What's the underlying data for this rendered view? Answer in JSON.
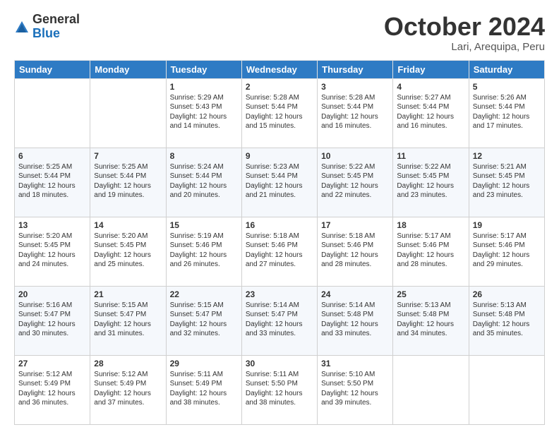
{
  "logo": {
    "general": "General",
    "blue": "Blue"
  },
  "header": {
    "month": "October 2024",
    "location": "Lari, Arequipa, Peru"
  },
  "weekdays": [
    "Sunday",
    "Monday",
    "Tuesday",
    "Wednesday",
    "Thursday",
    "Friday",
    "Saturday"
  ],
  "weeks": [
    [
      {
        "day": "",
        "info": ""
      },
      {
        "day": "",
        "info": ""
      },
      {
        "day": "1",
        "info": "Sunrise: 5:29 AM\nSunset: 5:43 PM\nDaylight: 12 hours and 14 minutes."
      },
      {
        "day": "2",
        "info": "Sunrise: 5:28 AM\nSunset: 5:44 PM\nDaylight: 12 hours and 15 minutes."
      },
      {
        "day": "3",
        "info": "Sunrise: 5:28 AM\nSunset: 5:44 PM\nDaylight: 12 hours and 16 minutes."
      },
      {
        "day": "4",
        "info": "Sunrise: 5:27 AM\nSunset: 5:44 PM\nDaylight: 12 hours and 16 minutes."
      },
      {
        "day": "5",
        "info": "Sunrise: 5:26 AM\nSunset: 5:44 PM\nDaylight: 12 hours and 17 minutes."
      }
    ],
    [
      {
        "day": "6",
        "info": "Sunrise: 5:25 AM\nSunset: 5:44 PM\nDaylight: 12 hours and 18 minutes."
      },
      {
        "day": "7",
        "info": "Sunrise: 5:25 AM\nSunset: 5:44 PM\nDaylight: 12 hours and 19 minutes."
      },
      {
        "day": "8",
        "info": "Sunrise: 5:24 AM\nSunset: 5:44 PM\nDaylight: 12 hours and 20 minutes."
      },
      {
        "day": "9",
        "info": "Sunrise: 5:23 AM\nSunset: 5:44 PM\nDaylight: 12 hours and 21 minutes."
      },
      {
        "day": "10",
        "info": "Sunrise: 5:22 AM\nSunset: 5:45 PM\nDaylight: 12 hours and 22 minutes."
      },
      {
        "day": "11",
        "info": "Sunrise: 5:22 AM\nSunset: 5:45 PM\nDaylight: 12 hours and 23 minutes."
      },
      {
        "day": "12",
        "info": "Sunrise: 5:21 AM\nSunset: 5:45 PM\nDaylight: 12 hours and 23 minutes."
      }
    ],
    [
      {
        "day": "13",
        "info": "Sunrise: 5:20 AM\nSunset: 5:45 PM\nDaylight: 12 hours and 24 minutes."
      },
      {
        "day": "14",
        "info": "Sunrise: 5:20 AM\nSunset: 5:45 PM\nDaylight: 12 hours and 25 minutes."
      },
      {
        "day": "15",
        "info": "Sunrise: 5:19 AM\nSunset: 5:46 PM\nDaylight: 12 hours and 26 minutes."
      },
      {
        "day": "16",
        "info": "Sunrise: 5:18 AM\nSunset: 5:46 PM\nDaylight: 12 hours and 27 minutes."
      },
      {
        "day": "17",
        "info": "Sunrise: 5:18 AM\nSunset: 5:46 PM\nDaylight: 12 hours and 28 minutes."
      },
      {
        "day": "18",
        "info": "Sunrise: 5:17 AM\nSunset: 5:46 PM\nDaylight: 12 hours and 28 minutes."
      },
      {
        "day": "19",
        "info": "Sunrise: 5:17 AM\nSunset: 5:46 PM\nDaylight: 12 hours and 29 minutes."
      }
    ],
    [
      {
        "day": "20",
        "info": "Sunrise: 5:16 AM\nSunset: 5:47 PM\nDaylight: 12 hours and 30 minutes."
      },
      {
        "day": "21",
        "info": "Sunrise: 5:15 AM\nSunset: 5:47 PM\nDaylight: 12 hours and 31 minutes."
      },
      {
        "day": "22",
        "info": "Sunrise: 5:15 AM\nSunset: 5:47 PM\nDaylight: 12 hours and 32 minutes."
      },
      {
        "day": "23",
        "info": "Sunrise: 5:14 AM\nSunset: 5:47 PM\nDaylight: 12 hours and 33 minutes."
      },
      {
        "day": "24",
        "info": "Sunrise: 5:14 AM\nSunset: 5:48 PM\nDaylight: 12 hours and 33 minutes."
      },
      {
        "day": "25",
        "info": "Sunrise: 5:13 AM\nSunset: 5:48 PM\nDaylight: 12 hours and 34 minutes."
      },
      {
        "day": "26",
        "info": "Sunrise: 5:13 AM\nSunset: 5:48 PM\nDaylight: 12 hours and 35 minutes."
      }
    ],
    [
      {
        "day": "27",
        "info": "Sunrise: 5:12 AM\nSunset: 5:49 PM\nDaylight: 12 hours and 36 minutes."
      },
      {
        "day": "28",
        "info": "Sunrise: 5:12 AM\nSunset: 5:49 PM\nDaylight: 12 hours and 37 minutes."
      },
      {
        "day": "29",
        "info": "Sunrise: 5:11 AM\nSunset: 5:49 PM\nDaylight: 12 hours and 38 minutes."
      },
      {
        "day": "30",
        "info": "Sunrise: 5:11 AM\nSunset: 5:50 PM\nDaylight: 12 hours and 38 minutes."
      },
      {
        "day": "31",
        "info": "Sunrise: 5:10 AM\nSunset: 5:50 PM\nDaylight: 12 hours and 39 minutes."
      },
      {
        "day": "",
        "info": ""
      },
      {
        "day": "",
        "info": ""
      }
    ]
  ]
}
